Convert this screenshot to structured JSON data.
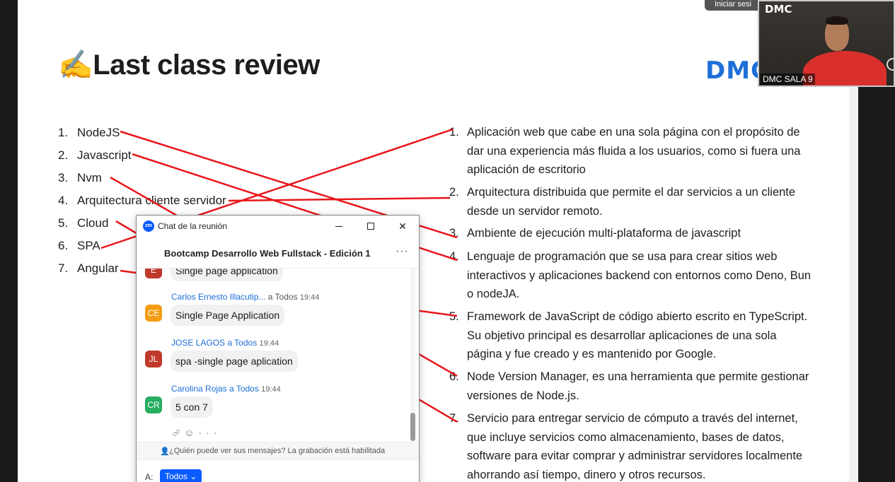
{
  "slide": {
    "title": "✍️Last class review",
    "logo": "DMC",
    "left_items": [
      {
        "num": "1.",
        "label": "NodeJS"
      },
      {
        "num": "2.",
        "label": "Javascript"
      },
      {
        "num": "3.",
        "label": "Nvm"
      },
      {
        "num": "4.",
        "label": "Arquitectura cliente servidor"
      },
      {
        "num": "5.",
        "label": "Cloud"
      },
      {
        "num": "6.",
        "label": "SPA"
      },
      {
        "num": "7.",
        "label": "Angular"
      }
    ],
    "right_items": [
      {
        "num": "1.",
        "text": "Aplicación web que cabe en una sola página con el propósito de dar una experiencia más fluida a los usuarios, como si fuera una aplicación de escritorio"
      },
      {
        "num": "2.",
        "text": "Arquitectura distribuida que permite el dar servicios a un cliente desde un servidor remoto."
      },
      {
        "num": "3.",
        "text": "Ambiente de ejecución multi-plataforma de javascript"
      },
      {
        "num": "4.",
        "text": "Lenguaje de programación que se usa para crear sitios web interactivos y aplicaciones backend con entornos como Deno, Bun o nodeJA."
      },
      {
        "num": "5.",
        "text": "Framework de JavaScript de código abierto escrito en TypeScript. Su objetivo principal es desarrollar aplicaciones de una sola página y fue creado y es mantenido por Google."
      },
      {
        "num": "6.",
        "text": "Node Version Manager, es una herramienta que permite gestionar versiones de Node.js."
      },
      {
        "num": "7.",
        "text": "Servicio para entregar servicio de cómputo a través del internet, que incluye servicios como almacenamiento, bases de datos, software para evitar comprar y administrar servidores localmente ahorrando así tiempo, dinero y otros recursos."
      }
    ],
    "annotation_color": "#e8161b"
  },
  "top_bar": {
    "signin_label": "Iniciar sesi"
  },
  "video": {
    "logo": "DMC",
    "participant_name": "DMC SALA 9"
  },
  "chat": {
    "window_title": "Chat de la reunión",
    "meeting_name": "Bootcamp Desarrollo Web Fullstack - Edición 1",
    "messages": [
      {
        "initials": "",
        "sender": "",
        "to": "",
        "time": "",
        "text": "Single page application",
        "avatar_color": "#c0392b"
      },
      {
        "initials": "CE",
        "sender": "Carlos Ernesto Illacutip...",
        "to": "a Todos",
        "time": "19:44",
        "text": "Single Page Application",
        "avatar_color": "#f39c12"
      },
      {
        "initials": "JL",
        "sender": "JOSE LAGOS",
        "to": "a Todos",
        "time": "19:44",
        "text": "spa -single page aplication",
        "avatar_color": "#c0392b"
      },
      {
        "initials": "CR",
        "sender": "Carolina Rojas",
        "to": "a Todos",
        "time": "19:44",
        "text": "5 con 7",
        "avatar_color": "#27ae60"
      }
    ],
    "privacy_note": "¿Quién puede ver sus mensajes? La grabación está habilitada",
    "to_label": "A:",
    "to_value": "Todos",
    "accent_color": "#0b5cff"
  }
}
